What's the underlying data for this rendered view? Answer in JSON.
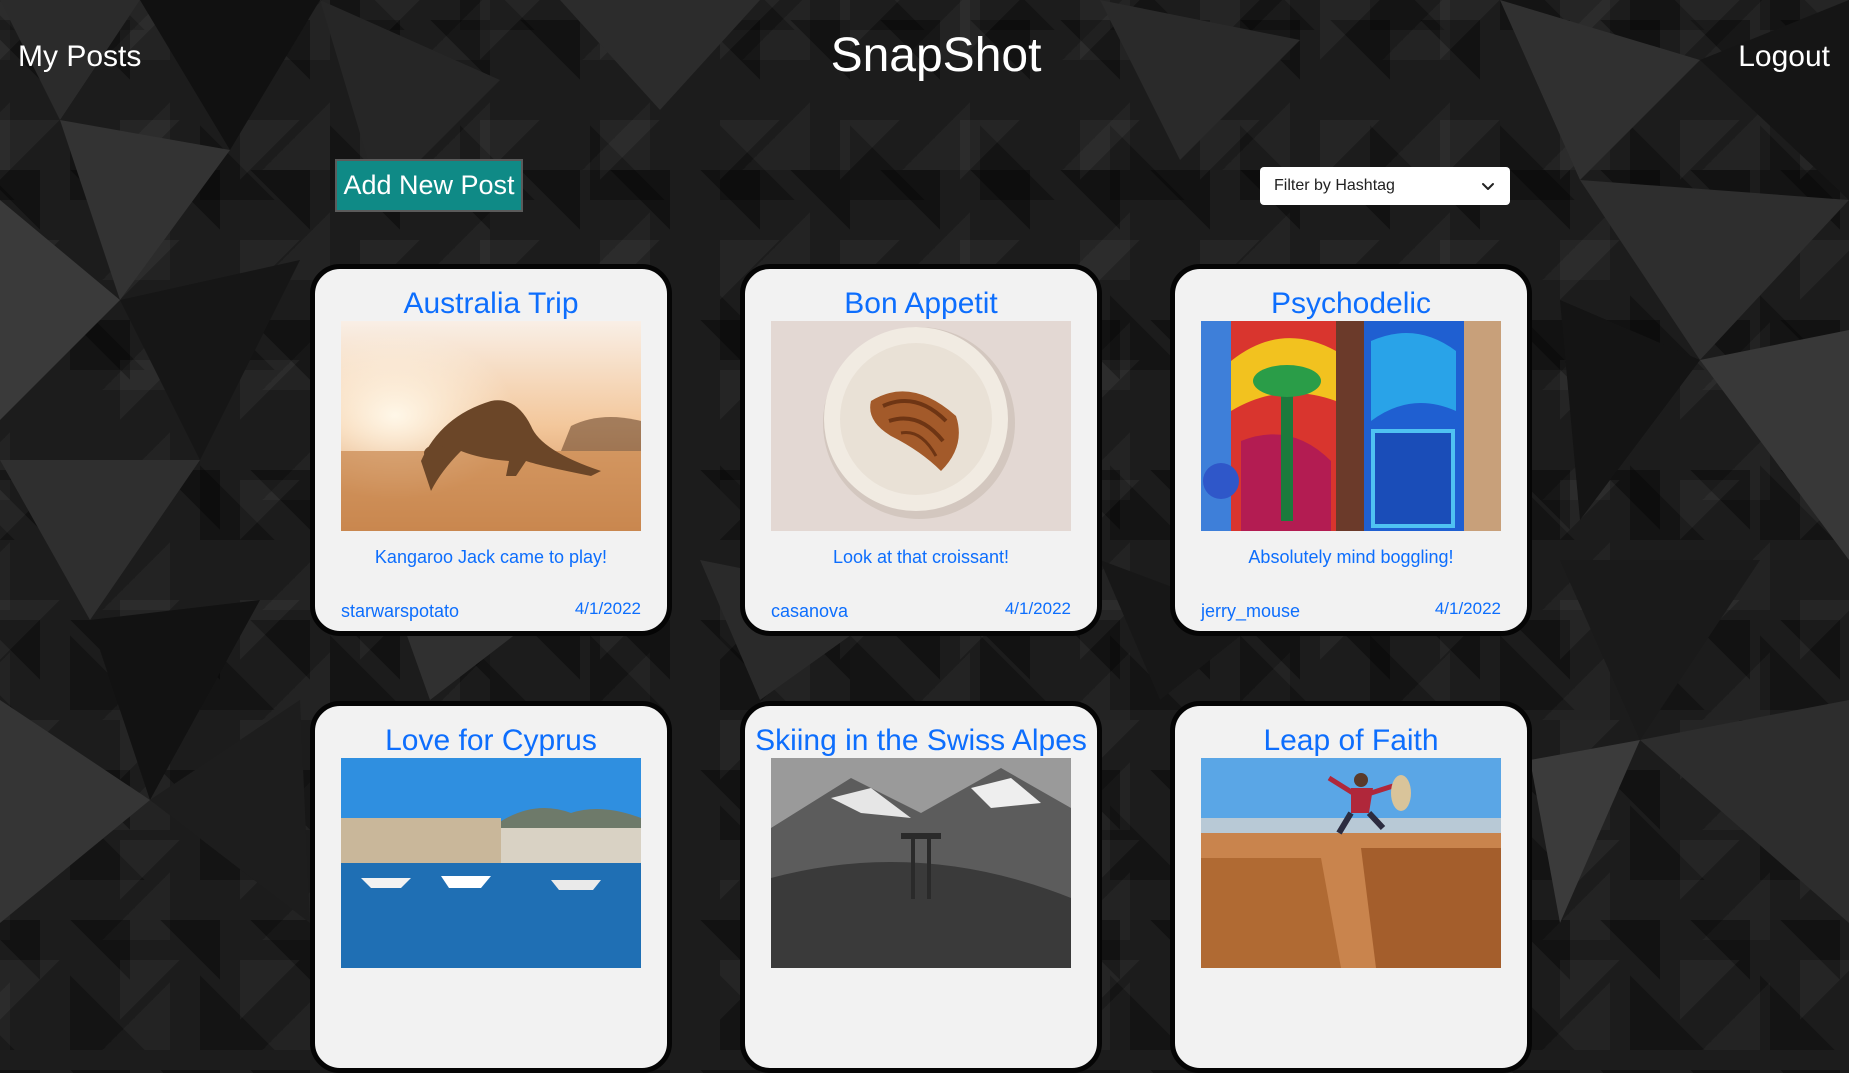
{
  "header": {
    "my_posts": "My Posts",
    "brand": "SnapShot",
    "logout": "Logout"
  },
  "toolbar": {
    "add_post_label": "Add New Post",
    "filter_label": "Filter by Hashtag"
  },
  "colors": {
    "accent_button": "#0f8a86",
    "link_blue": "#0d6efd",
    "card_bg": "#f2f2f2",
    "page_bg": "#1c1c1c"
  },
  "posts": [
    {
      "title": "Australia Trip",
      "caption": "Kangaroo Jack came to play!",
      "user": "starwarspotato",
      "date": "4/1/2022",
      "image": "kangaroo-photo"
    },
    {
      "title": "Bon Appetit",
      "caption": "Look at that croissant!",
      "user": "casanova",
      "date": "4/1/2022",
      "image": "croissant-photo"
    },
    {
      "title": "Psychodelic",
      "caption": "Absolutely mind boggling!",
      "user": "jerry_mouse",
      "date": "4/1/2022",
      "image": "painted-doors-photo"
    },
    {
      "title": "Love for Cyprus",
      "caption": "",
      "user": "",
      "date": "",
      "image": "harbor-photo"
    },
    {
      "title": "Skiing in the Swiss Alpes",
      "caption": "",
      "user": "",
      "date": "",
      "image": "alps-photo"
    },
    {
      "title": "Leap of Faith",
      "caption": "",
      "user": "",
      "date": "",
      "image": "canyon-jump-photo"
    }
  ]
}
